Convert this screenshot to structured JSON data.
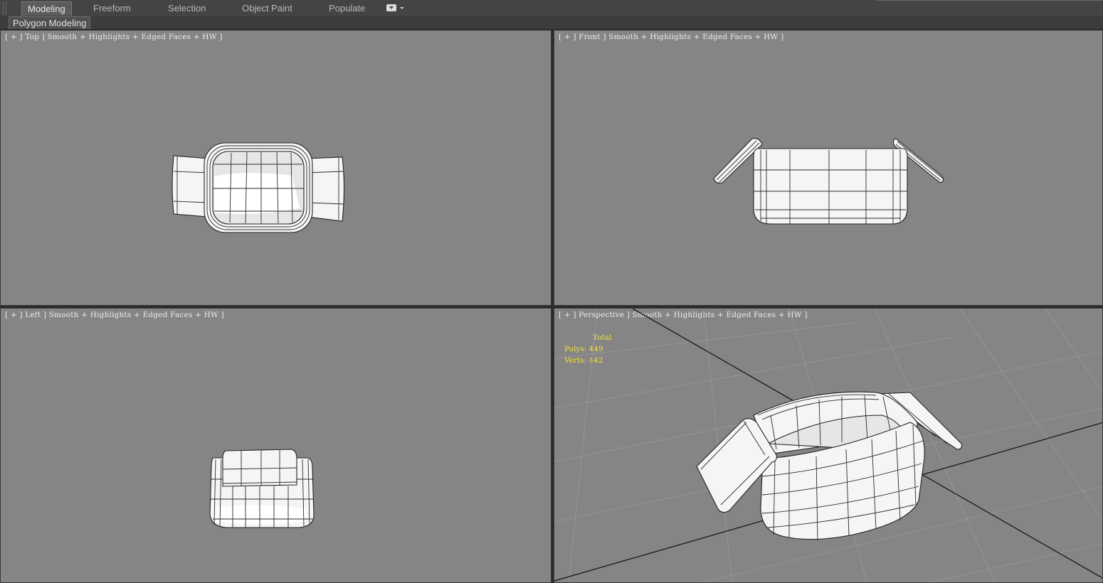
{
  "ribbon": {
    "tabs": [
      {
        "label": "Modeling",
        "active": true
      },
      {
        "label": "Freeform",
        "active": false
      },
      {
        "label": "Selection",
        "active": false
      },
      {
        "label": "Object Paint",
        "active": false
      },
      {
        "label": "Populate",
        "active": false
      }
    ],
    "dropdown_icon": "ribbon-options-icon"
  },
  "subbar": {
    "active_panel": "Polygon Modeling"
  },
  "viewports": [
    {
      "label": "[ + ] Top ] Smooth + Highlights + Edged Faces + HW ]"
    },
    {
      "label": "[ + ] Front ] Smooth + Highlights + Edged Faces + HW ]"
    },
    {
      "label": "[ + ] Left ] Smooth + Highlights + Edged Faces + HW ]"
    },
    {
      "label": "[ + ] Perspective ] Smooth + Highlights + Edged Faces + HW ]"
    }
  ],
  "stats": {
    "title": "Total",
    "polys_label": "Polys:",
    "polys": "449",
    "verts_label": "Verts:",
    "verts": "442"
  },
  "colors": {
    "viewport_bg": "#858585",
    "stats_text": "#f3e33a",
    "ribbon_bg": "#444444"
  }
}
